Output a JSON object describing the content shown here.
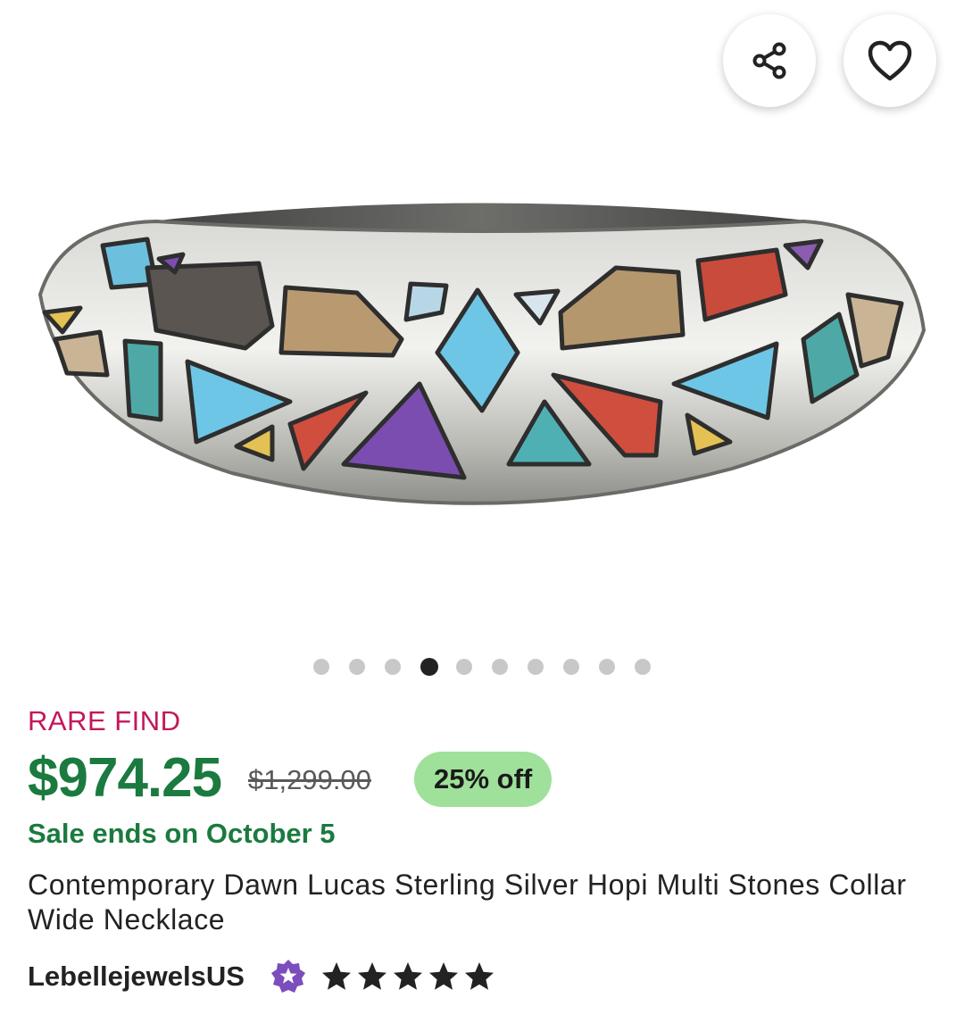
{
  "gallery": {
    "image_alt": "Contemporary Dawn Lucas Sterling Silver Hopi Multi Stones Collar Wide Necklace",
    "total_images": 10,
    "active_index": 3
  },
  "actions": {
    "share_icon": "share-icon",
    "favorite_icon": "heart-outline-icon"
  },
  "listing": {
    "tag": "RARE FIND",
    "price": "$974.25",
    "original_price": "$1,299.00",
    "discount": "25% off",
    "sale_text": "Sale ends on October 5",
    "title": "Contemporary Dawn Lucas Sterling Silver Hopi Multi Stones Collar Wide Necklace"
  },
  "seller": {
    "name": "LebellejewelsUS",
    "badge_icon": "star-seller-badge-icon",
    "rating": 5,
    "rating_max": 5
  },
  "colors": {
    "rare_find": "#c2185b",
    "price_green": "#1b7a3f",
    "discount_badge": "#9fe09a",
    "star_seller_purple": "#7c4dbd"
  }
}
